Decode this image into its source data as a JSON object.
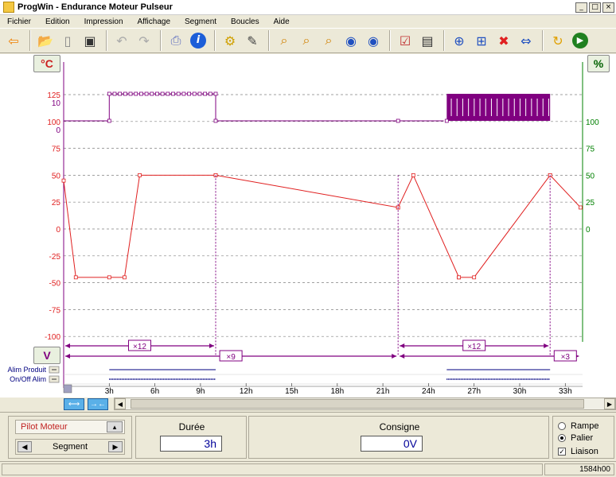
{
  "window": {
    "title": "ProgWin - Endurance Moteur Pulseur",
    "min": "_",
    "max": "□",
    "close": "×"
  },
  "menu": [
    "Fichier",
    "Edition",
    "Impression",
    "Affichage",
    "Segment",
    "Boucles",
    "Aide"
  ],
  "toolbar": {
    "icons": [
      "back-arrow-icon",
      "open-folder-icon",
      "new-file-icon",
      "save-disk-icon",
      "undo-icon",
      "redo-icon",
      "print-icon",
      "info-icon",
      "settings-gear-icon",
      "edit-pencil-icon",
      "zoom-in-icon",
      "zoom-fit-icon",
      "zoom-out-icon",
      "view-eye-icon",
      "view-eye-alt-icon",
      "checklist-icon",
      "display-icon",
      "segment-add-icon",
      "segment-insert-icon",
      "segment-delete-icon",
      "segment-link-icon",
      "loop-icon",
      "run-icon"
    ]
  },
  "axes": {
    "left_unit": "°C",
    "right_unit": "%",
    "lower_unit": "V",
    "temp_ticks": [
      "125",
      "100",
      "75",
      "50",
      "25",
      "0",
      "-25",
      "-50",
      "-75",
      "-100"
    ],
    "relay_ticks_left": [
      "10",
      "0"
    ],
    "pct_ticks": [
      "100",
      "75",
      "50",
      "25",
      "0"
    ],
    "time_ticks": [
      "3h",
      "6h",
      "9h",
      "12h",
      "15h",
      "18h",
      "21h",
      "24h",
      "27h",
      "30h",
      "33h"
    ],
    "loops": [
      "×12",
      "×9",
      "×12",
      "×3"
    ],
    "channels": [
      "Alim Produit",
      "On/Off Alim"
    ]
  },
  "colors": {
    "temp": "#e02020",
    "relay": "#800080",
    "pct": "#008000",
    "channel": "#000080",
    "grid": "#808080"
  },
  "chart_data": {
    "type": "line",
    "xlabel": "",
    "ylabel": "°C",
    "x_ticks": [
      "3h",
      "6h",
      "9h",
      "12h",
      "15h",
      "18h",
      "21h",
      "24h",
      "27h",
      "30h",
      "33h"
    ],
    "series": [
      {
        "x": [
          "0h",
          "0.8h",
          "3h",
          "4h",
          "5h",
          "10h",
          "10h",
          "22h",
          "22h",
          "23h",
          "26h",
          "26h",
          "27h",
          "32h",
          "32h",
          "34h"
        ],
        "values": [
          45,
          -45,
          -45,
          -45,
          50,
          50,
          50,
          20,
          20,
          50,
          -45,
          -45,
          -45,
          50,
          50,
          20
        ]
      }
    ]
  },
  "bottom": {
    "pilot_label": "Pilot Moteur",
    "segment_label": "Segment",
    "duree_label": "Durée",
    "duree_value": "3h",
    "consigne_label": "Consigne",
    "consigne_value": "0V",
    "rampe_label": "Rampe",
    "palier_label": "Palier",
    "liaison_label": "Liaison"
  },
  "status": {
    "time": "1584h00"
  }
}
